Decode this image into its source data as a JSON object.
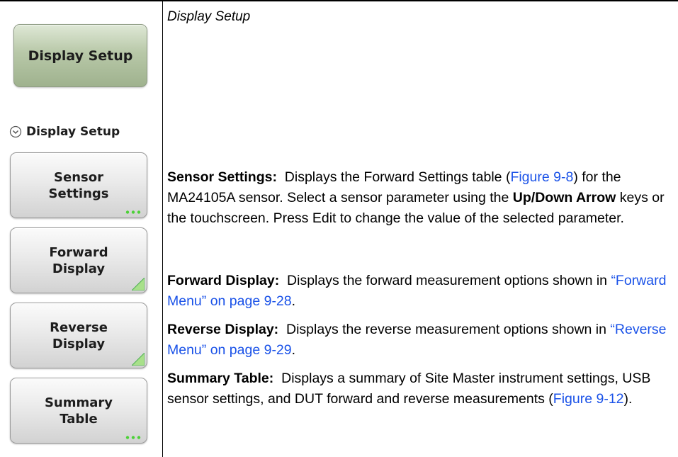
{
  "caption": "Display Setup",
  "menu": {
    "title_button": "Display Setup",
    "header": "Display Setup",
    "buttons": [
      {
        "line1": "Sensor",
        "line2": "Settings",
        "indicator": "dots"
      },
      {
        "line1": "Forward",
        "line2": "Display",
        "indicator": "triangle"
      },
      {
        "line1": "Reverse",
        "line2": "Display",
        "indicator": "triangle"
      },
      {
        "line1": "Summary",
        "line2": "Table",
        "indicator": "dots"
      }
    ]
  },
  "descriptions": {
    "sensor_settings": {
      "term": "Sensor Settings:",
      "t1": "Displays the Forward Settings table (",
      "link": "Figure 9-8",
      "t2": ") for the MA24105A sensor. Select a sensor parameter using the ",
      "bold": "Up/Down Arrow",
      "t3": " keys or the touchscreen. Press Edit to change the value of the selected parameter."
    },
    "forward_display": {
      "term": "Forward Display:",
      "t1": "Displays the forward measurement options shown in ",
      "link": "“Forward Menu” on page 9-28",
      "t2": "."
    },
    "reverse_display": {
      "term": "Reverse Display:",
      "t1": "Displays the reverse measurement options shown in ",
      "link": "“Reverse Menu” on page 9-29",
      "t2": "."
    },
    "summary_table": {
      "term": "Summary Table:",
      "t1": "Displays a summary of Site Master instrument settings, USB sensor settings, and DUT forward and reverse measurements (",
      "link": "Figure 9-12",
      "t2": ")."
    }
  },
  "colors": {
    "link": "#1a52e8",
    "title_button": "#b8c8a8",
    "softkey": "#e4e4e4",
    "indicator_green": "#4cd137"
  }
}
